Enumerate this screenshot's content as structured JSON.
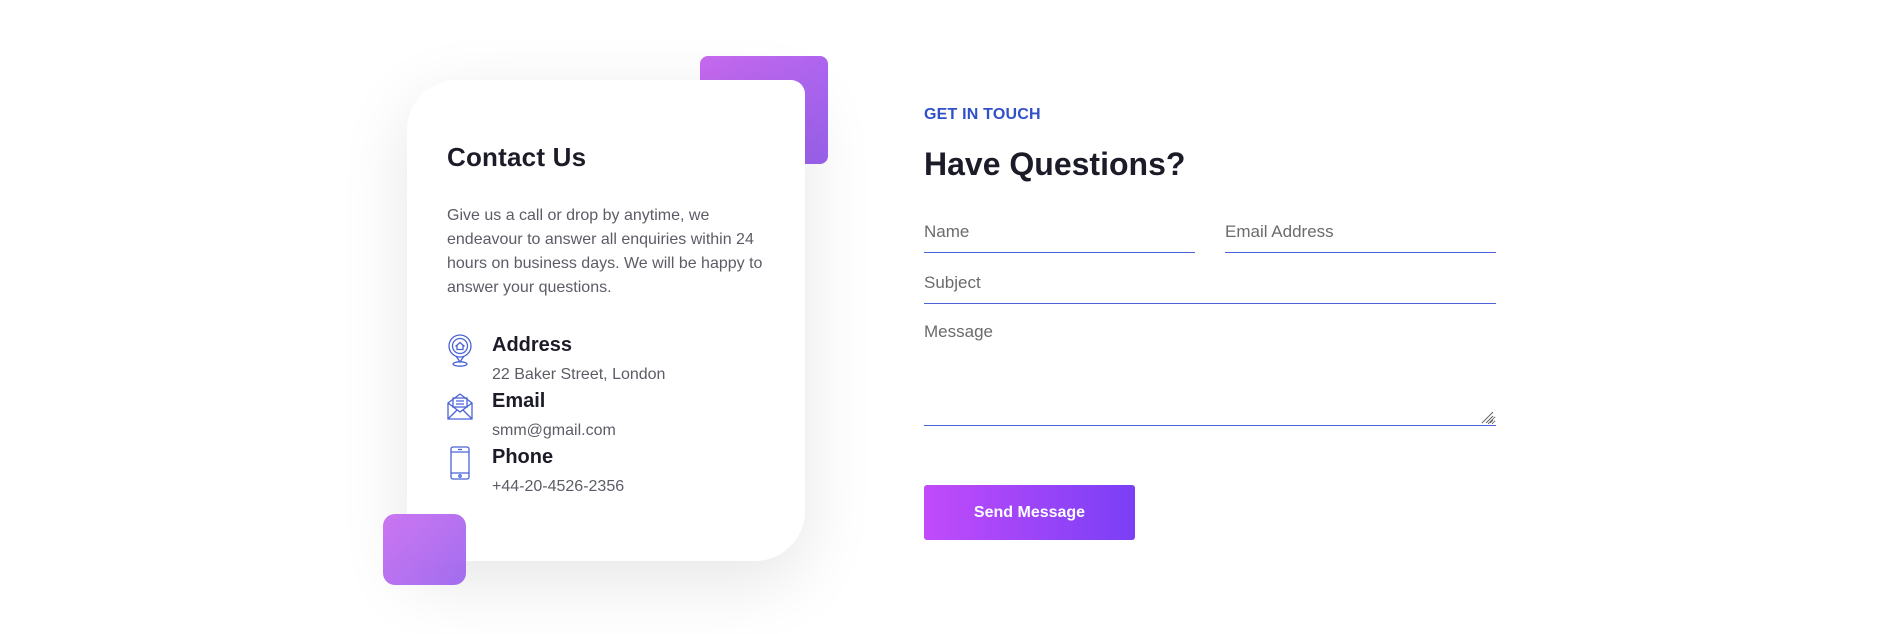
{
  "contact_card": {
    "title": "Contact Us",
    "description": "Give us a call or drop by anytime, we endeavour to answer all enquiries within 24 hours on business days. We will be happy to answer your questions.",
    "items": [
      {
        "icon": "location-pin-icon",
        "title": "Address",
        "value": "22 Baker Street, London"
      },
      {
        "icon": "envelope-icon",
        "title": "Email",
        "value": "smm@gmail.com"
      },
      {
        "icon": "smartphone-icon",
        "title": "Phone",
        "value": "+44-20-4526-2356"
      }
    ]
  },
  "form": {
    "eyebrow": "GET IN TOUCH",
    "heading": "Have Questions?",
    "name_placeholder": "Name",
    "email_placeholder": "Email Address",
    "subject_placeholder": "Subject",
    "message_placeholder": "Message",
    "submit_label": "Send Message"
  },
  "colors": {
    "accent_blue": "#2f50c8",
    "gradient_start": "#c14bfb",
    "gradient_end": "#7a3ff5"
  }
}
